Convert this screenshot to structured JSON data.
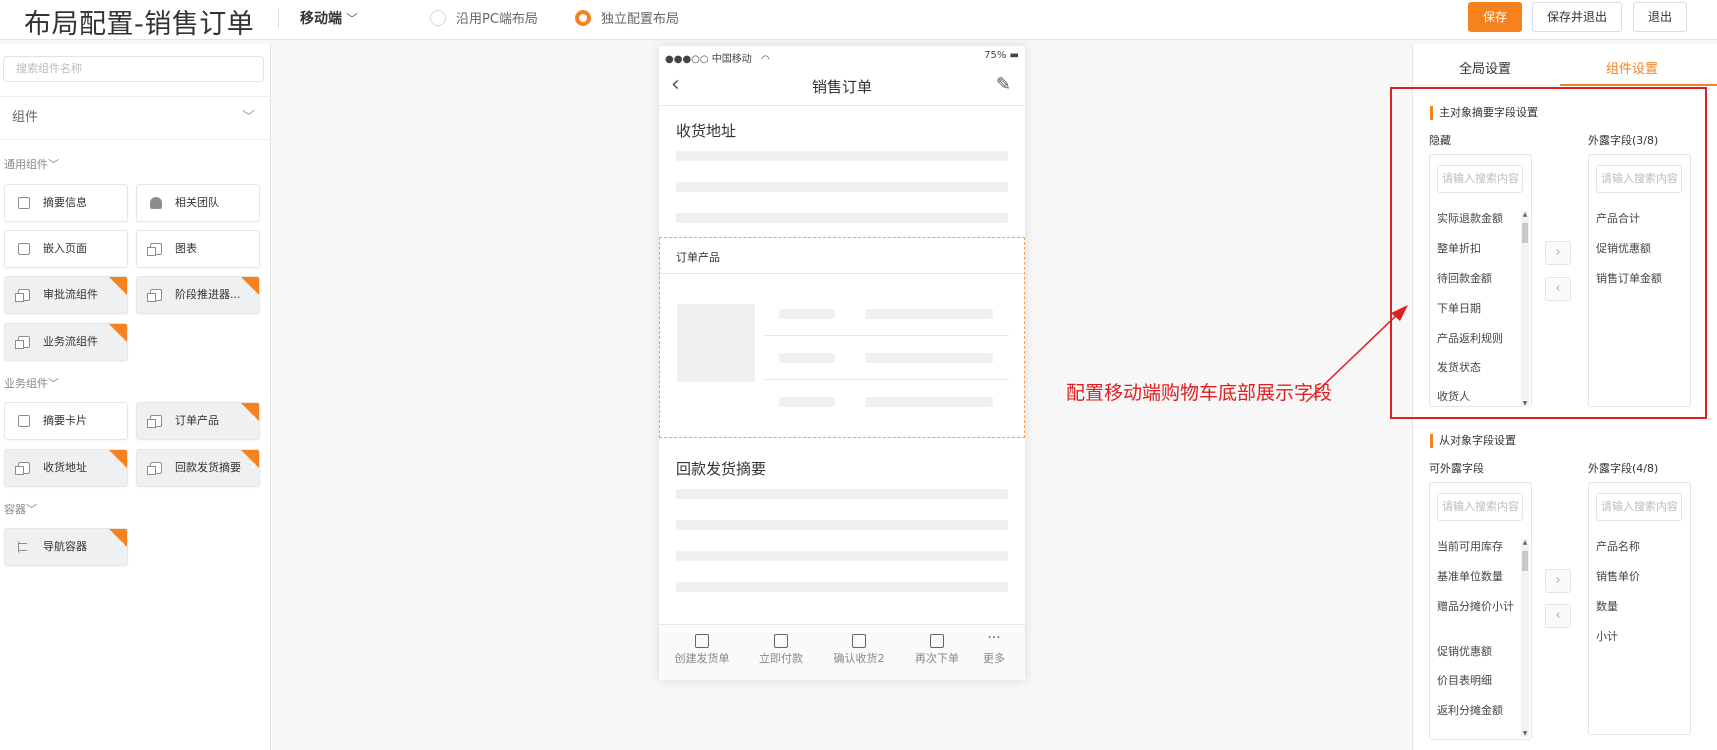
{
  "header": {
    "title": "布局配置-销售订单",
    "device": "移动端",
    "radio_pc": "沿用PC端布局",
    "radio_independent": "独立配置布局",
    "save": "保存",
    "save_exit": "保存并退出",
    "exit": "退出",
    "accent": "#f6821f"
  },
  "left": {
    "search_placeholder": "搜索组件名称",
    "components_label": "组件",
    "general_group": "通用组件",
    "business_group": "业务组件",
    "container_group": "容器",
    "general_items": [
      "摘要信息",
      "相关团队",
      "嵌入页面",
      "图表",
      "审批流组件",
      "阶段推进器...",
      "业务流组件"
    ],
    "business_items": [
      "摘要卡片",
      "订单产品",
      "收货地址",
      "回款发货摘要"
    ],
    "container_items": [
      "导航容器"
    ]
  },
  "phone": {
    "carrier": "●●●○○ 中国移动",
    "battery": "75%",
    "title": "销售订单",
    "section_address": "收货地址",
    "section_products": "订单产品",
    "section_summary": "回款发货摘要",
    "tabs": [
      "创建发货单",
      "立即付款",
      "确认收货2",
      "再次下单",
      "更多"
    ]
  },
  "annotation": "配置移动端购物车底部展示字段",
  "right": {
    "tab_global": "全局设置",
    "tab_component": "组件设置",
    "main_section": "主对象摘要字段设置",
    "main_hidden_label": "隐藏",
    "main_shown_label": "外露字段(3/8)",
    "search_placeholder": "请输入搜索内容",
    "main_hidden_items": [
      "实际退款金额",
      "整单折扣",
      "待回款金额",
      "下单日期",
      "产品返利规则",
      "发货状态",
      "收货人"
    ],
    "main_shown_items": [
      "产品合计",
      "促销优惠额",
      "销售订单金额"
    ],
    "sub_section": "从对象字段设置",
    "sub_available_label": "可外露字段",
    "sub_shown_label": "外露字段(4/8)",
    "sub_available_items": [
      "当前可用库存",
      "基准单位数量",
      "赠品分摊价小计",
      "促销优惠额",
      "价目表明细",
      "返利分摊金额"
    ],
    "sub_shown_items": [
      "产品名称",
      "销售单价",
      "数量",
      "小计"
    ],
    "arrow_right": "›",
    "arrow_left": "‹"
  }
}
